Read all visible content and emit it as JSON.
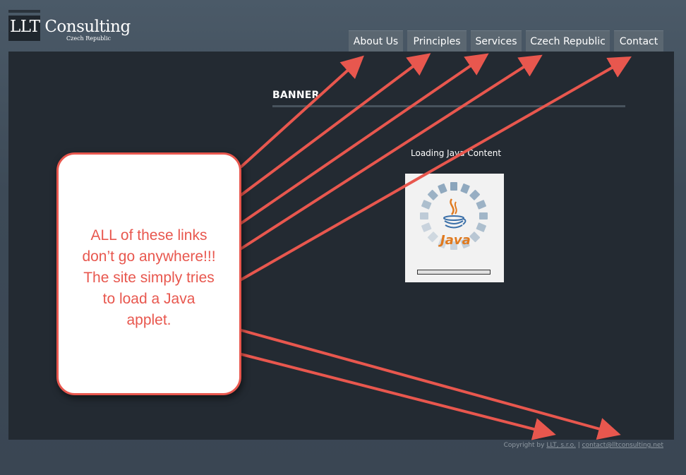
{
  "logo": {
    "title": "LLT Consulting",
    "subtitle": "Czech Republic"
  },
  "nav": {
    "tabs": [
      "About Us",
      "Principles",
      "Services",
      "Czech Republic",
      "Contact"
    ]
  },
  "banner": {
    "title": "BANNER"
  },
  "applet": {
    "loading_text": "Loading Java Content",
    "logo_word": "Java"
  },
  "footer": {
    "copyright": "Copyright by",
    "company_link": "LLT, s.r.o.",
    "separator": "|",
    "email_link": "contact@lltconsulting.net"
  },
  "annotation": {
    "lines": [
      "ALL of these links",
      "don’t go anywhere!!!",
      "The site simply tries",
      "to load a Java",
      "applet."
    ],
    "color": "#e8574e"
  },
  "colors": {
    "background": "#4b5a68",
    "content": "#232a32",
    "nav_tab": "#5b6771",
    "accent": "#e8574e",
    "java_orange": "#e07a1f"
  }
}
